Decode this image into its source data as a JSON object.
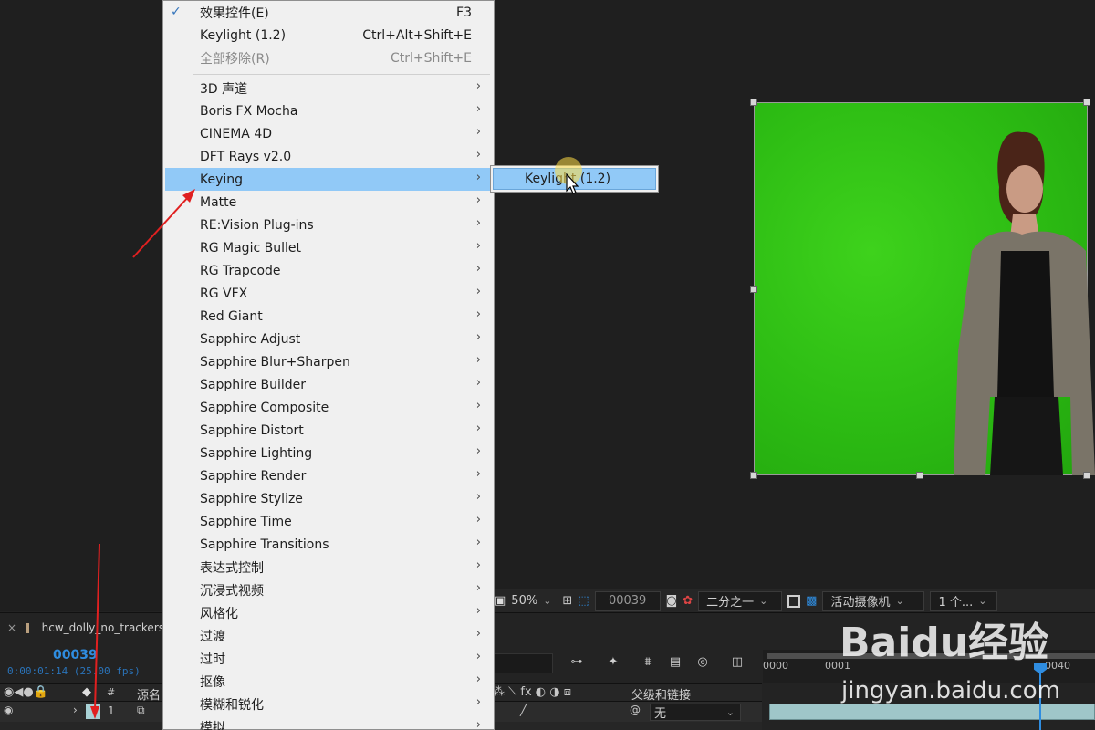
{
  "menu": {
    "top_items": [
      {
        "label": "效果控件(E)",
        "shortcut": "F3",
        "checked": true,
        "disabled": false
      },
      {
        "label": "Keylight (1.2)",
        "shortcut": "Ctrl+Alt+Shift+E",
        "checked": false,
        "disabled": false
      },
      {
        "label": "全部移除(R)",
        "shortcut": "Ctrl+Shift+E",
        "checked": false,
        "disabled": true
      }
    ],
    "categories": [
      {
        "label": "3D 声道"
      },
      {
        "label": "Boris FX Mocha"
      },
      {
        "label": "CINEMA 4D"
      },
      {
        "label": "DFT Rays v2.0"
      },
      {
        "label": "Keying",
        "highlighted": true
      },
      {
        "label": "Matte"
      },
      {
        "label": "RE:Vision Plug-ins"
      },
      {
        "label": "RG Magic Bullet"
      },
      {
        "label": "RG Trapcode"
      },
      {
        "label": "RG VFX"
      },
      {
        "label": "Red Giant"
      },
      {
        "label": "Sapphire Adjust"
      },
      {
        "label": "Sapphire Blur+Sharpen"
      },
      {
        "label": "Sapphire Builder"
      },
      {
        "label": "Sapphire Composite"
      },
      {
        "label": "Sapphire Distort"
      },
      {
        "label": "Sapphire Lighting"
      },
      {
        "label": "Sapphire Render"
      },
      {
        "label": "Sapphire Stylize"
      },
      {
        "label": "Sapphire Time"
      },
      {
        "label": "Sapphire Transitions"
      },
      {
        "label": "表达式控制"
      },
      {
        "label": "沉浸式视频"
      },
      {
        "label": "风格化"
      },
      {
        "label": "过渡"
      },
      {
        "label": "过时"
      },
      {
        "label": "抠像"
      },
      {
        "label": "模糊和锐化"
      },
      {
        "label": "模拟"
      }
    ],
    "submenu_item": "Keylight (1.2)"
  },
  "viewer_toolbar": {
    "zoom": "50%",
    "frame": "00039",
    "resolution": "二分之一",
    "camera": "活动摄像机",
    "views": "1 个..."
  },
  "timeline": {
    "comp_name": "hcw_dolly_no_trackers",
    "timecode": "00039",
    "fps_line": "0:00:01:14 (25.00 fps)",
    "layer_number": "1",
    "source_header": "源名",
    "parent_header": "父级和链接",
    "parent_value": "无",
    "hash_header": "#",
    "ruler_ticks": [
      "0000",
      "0001",
      "0040"
    ]
  },
  "watermark": {
    "logo": "Baidu经验",
    "url": "jingyan.baidu.com"
  },
  "colors": {
    "menu_highlight": "#91c9f7",
    "timecode_blue": "#2f8de0",
    "annotation_arrow": "#e02020",
    "green_screen": "#33c217"
  }
}
